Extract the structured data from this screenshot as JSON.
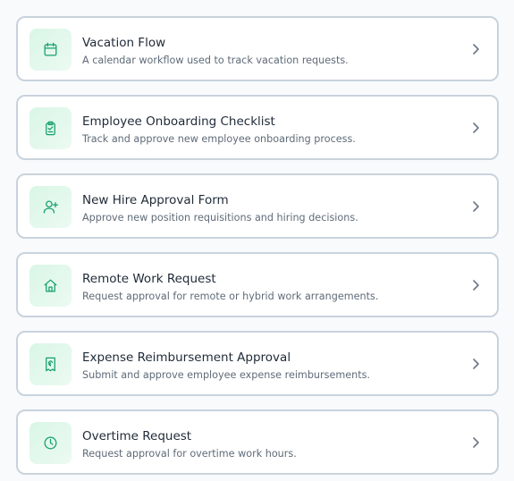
{
  "workflows": [
    {
      "title": "Vacation Flow",
      "description": "A calendar workflow used to track vacation requests.",
      "icon": "calendar-icon"
    },
    {
      "title": "Employee Onboarding Checklist",
      "description": "Track and approve new employee onboarding process.",
      "icon": "clipboard-icon"
    },
    {
      "title": "New Hire Approval Form",
      "description": "Approve new position requisitions and hiring decisions.",
      "icon": "user-plus-icon"
    },
    {
      "title": "Remote Work Request",
      "description": "Request approval for remote or hybrid work arrangements.",
      "icon": "home-icon"
    },
    {
      "title": "Expense Reimbursement Approval",
      "description": "Submit and approve employee expense reimbursements.",
      "icon": "receipt-icon"
    },
    {
      "title": "Overtime Request",
      "description": "Request approval for overtime work hours.",
      "icon": "clock-icon"
    }
  ],
  "colors": {
    "accent": "#16a06a",
    "icon_bg": "#e4f8ed",
    "card_border": "#c9d3dd",
    "title_text": "#1f2a37",
    "description_text": "#5f6b78"
  }
}
